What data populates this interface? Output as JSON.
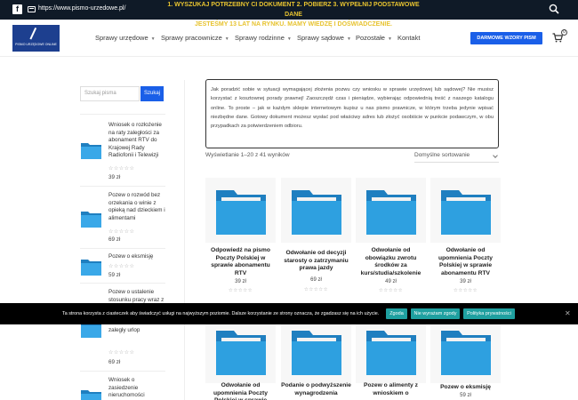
{
  "topbar": {
    "facebook_icon": "facebook-icon",
    "url": "https://www.pismo-urzedowe.pl/",
    "promo_line1": "1. WYSZUKAJ POTRZEBNY CI DOKUMENT 2. POBIERZ 3. WYPEŁNIJ PODSTAWOWE DANE",
    "promo_line2": "JESTEŚMY 13 LAT NA RYNKU. MAMY WIEDZĘ I DOŚWIADCZENIE.",
    "search_icon": "search-icon",
    "color_bg": "#0f1a27",
    "color_promo": "#e7c330"
  },
  "header": {
    "logo_text": "PISMO URZĘDOWE ONLINE",
    "nav": [
      "Sprawy urzędowe",
      "Sprawy pracownicze",
      "Sprawy rodzinne",
      "Sprawy sądowe",
      "Pozostałe",
      "Kontakt"
    ],
    "cta_label": "DARMOWE WZORY PISM",
    "cart_count": "0",
    "color_accent": "#1a5fe8"
  },
  "sidebar": {
    "search_placeholder": "Szukaj pisma",
    "search_button": "Szukaj",
    "items": [
      {
        "title": "Wniosek o rozłożenie na raty zaległości za abonament RTV do Krajowej Rady Radiofonii i Telewizji",
        "price": "39 zł"
      },
      {
        "title": "Pozew o rozwód bez orzekania o winie z opieką nad dzieckiem i alimentami",
        "price": "69 zł"
      },
      {
        "title": "Pozew o eksmisję",
        "price": "59 zł"
      },
      {
        "title": "Pozew o ustalenie stosunku pracy wraz z wypłatą godziny nadliczbowe i ekwiwalentu za zaległy urlop",
        "price": "69 zł"
      },
      {
        "title": "Wniosek o zasiedzenie nieruchomości",
        "price": ""
      }
    ]
  },
  "main": {
    "info": "Jak poradzić sobie w sytuacji wymagającej złożenia pozwu czy wniosku w sprawie urzędowej lub sądowej? Nie musisz korzystać z kosztownej porady prawnej! Zaoszczędź czas i pieniądze, wybierając odpowiednią treść z naszego katalogu online. To proste – jak w każdym sklepie internetowym kupisz u nas pismo prawnicze, w którym trzeba jedynie wpisać niezbędne dane. Gotowy dokument możesz wysłać pod właściwy adres lub złożyć osobiście w punkcie podawczym, w obu przypadkach za potwierdzeniem odbioru.",
    "results": "Wyświetlanie 1–20 z 41 wyników",
    "sort": "Domyślne sortowanie",
    "products": [
      {
        "title": "Odpowiedź na pismo Poczty Polskiej w sprawie abonamentu RTV",
        "price": "39 zł"
      },
      {
        "title": "Odwołanie od decyzji starosty o zatrzymaniu prawa jazdy",
        "price": "69 zł"
      },
      {
        "title": "Odwołanie od obowiązku zwrotu środków za kurs/studia/szkolenie",
        "price": "49 zł"
      },
      {
        "title": "Odwołanie od upomnienia Poczty Polskiej w sprawie abonamentu RTV",
        "price": "39 zł"
      },
      {
        "title": "Odwołanie od upomnienia Poczty Polskiej w sprawie",
        "price": ""
      },
      {
        "title": "Podanie o podwyższenie wynagrodzenia",
        "price": ""
      },
      {
        "title": "Pozew o alimenty z wnioskiem o",
        "price": ""
      },
      {
        "title": "Pozew o eksmisję",
        "price": "59 zł"
      }
    ],
    "folder_color": "#2ea0e0"
  },
  "cookie": {
    "text": "Ta strona korzysta z ciasteczek aby świadczyć usługi na najwyższym poziomie. Dalsze korzystanie ze strony oznacza, że zgadzasz się na ich użycie.",
    "accept": "Zgoda",
    "decline": "Nie wyrażam zgody",
    "policy": "Polityka prywatności"
  }
}
